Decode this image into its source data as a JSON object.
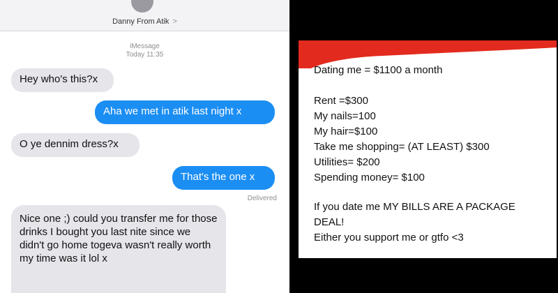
{
  "conversation": {
    "contact_name": "Danny From Atik",
    "chevron": ">",
    "service": "iMessage",
    "timestamp": "Today 11:35",
    "delivered_label": "Delivered",
    "messages": [
      {
        "from": "them",
        "text": "Hey who's this?x"
      },
      {
        "from": "me",
        "text": "Aha we met in atik last night x"
      },
      {
        "from": "them",
        "text": "O ye dennim dress?x"
      },
      {
        "from": "me",
        "text": "That's the one x"
      },
      {
        "from": "them",
        "text": "Nice one ;) could you transfer me for those drinks I bought you last nite since we didn't go home togeva wasn't really worth my time was it lol x"
      }
    ]
  },
  "post": {
    "accent_color": "#e32a1e",
    "lines": [
      "Dating me = $1100 a month",
      "Rent =$300",
      "My nails=100",
      "My hair=$100",
      "Take me shopping= (AT LEAST) $300",
      "Utilities= $200",
      "Spending money= $100",
      "If you date me MY BILLS ARE A PACKAGE",
      "DEAL!",
      "Either you support me or gtfo <3"
    ]
  }
}
